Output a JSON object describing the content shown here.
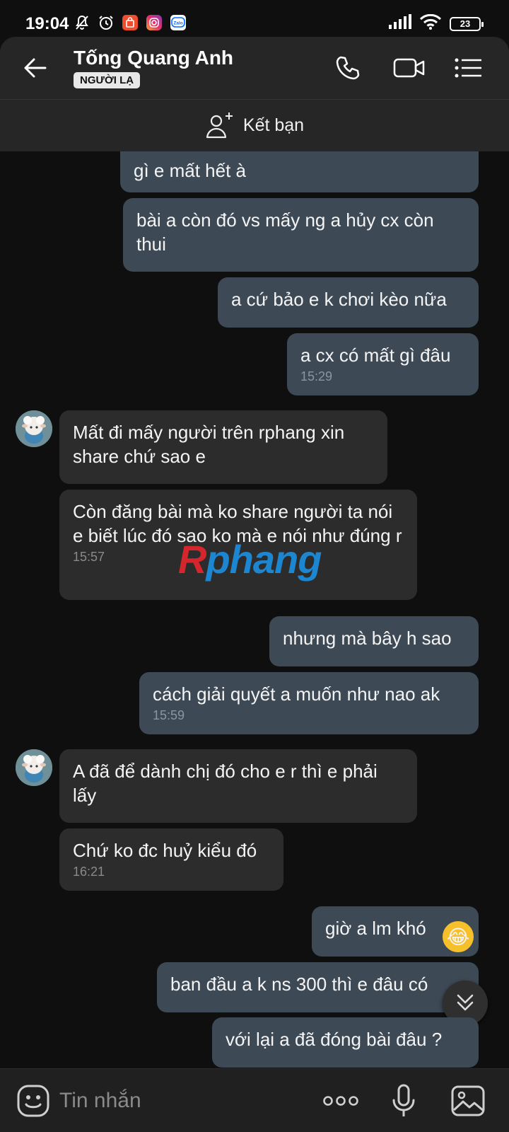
{
  "status_bar": {
    "time": "19:04",
    "battery": "23",
    "icons": [
      "mute-icon",
      "alarm-icon",
      "shopee-icon",
      "instagram-icon",
      "zalo-icon",
      "signal-icon",
      "wifi-icon",
      "battery-icon"
    ]
  },
  "header": {
    "name": "Tống Quang Anh",
    "badge": "NGƯỜI LẠ"
  },
  "friend_bar": {
    "label": "Kết bạn"
  },
  "messages": [
    {
      "side": "out",
      "text": "gì e mất hết à"
    },
    {
      "side": "out",
      "text": "bài a còn đó vs mấy ng a hủy cx còn thui"
    },
    {
      "side": "out",
      "text": "a cứ bảo e k chơi kèo nữa"
    },
    {
      "side": "out",
      "text": "a cx có mất gì đâu",
      "time": "15:29"
    },
    {
      "side": "in",
      "text": "Mất đi mấy người trên rphang xin share chứ sao e"
    },
    {
      "side": "in",
      "text": "Còn đăng bài mà ko share người ta nói e biết lúc đó sao ko mà e nói như đúng r",
      "time": "15:57"
    },
    {
      "side": "out",
      "text": "nhưng mà bây h sao"
    },
    {
      "side": "out",
      "text": "cách giải quyết a muốn như nao ak",
      "time": "15:59"
    },
    {
      "side": "in",
      "text": "A đã để dành chị đó cho e r thì e phải lấy"
    },
    {
      "side": "in",
      "text": "Chứ ko đc huỷ kiểu đó",
      "time": "16:21"
    },
    {
      "side": "out",
      "text": "giờ a lm khó"
    },
    {
      "side": "out",
      "text": "ban đầu a k ns 300 thì e đâu có"
    },
    {
      "side": "out",
      "text": "với lại a đã đóng bài đâu ?"
    }
  ],
  "watermark": {
    "r": "R",
    "rest": "phang"
  },
  "input": {
    "placeholder": "Tin nhắn",
    "more_label": "ooo"
  },
  "colors": {
    "outgoing_bubble": "#3e4956",
    "incoming_bubble": "#2c2c2c",
    "background": "#0f0f0f",
    "header": "#262626"
  }
}
